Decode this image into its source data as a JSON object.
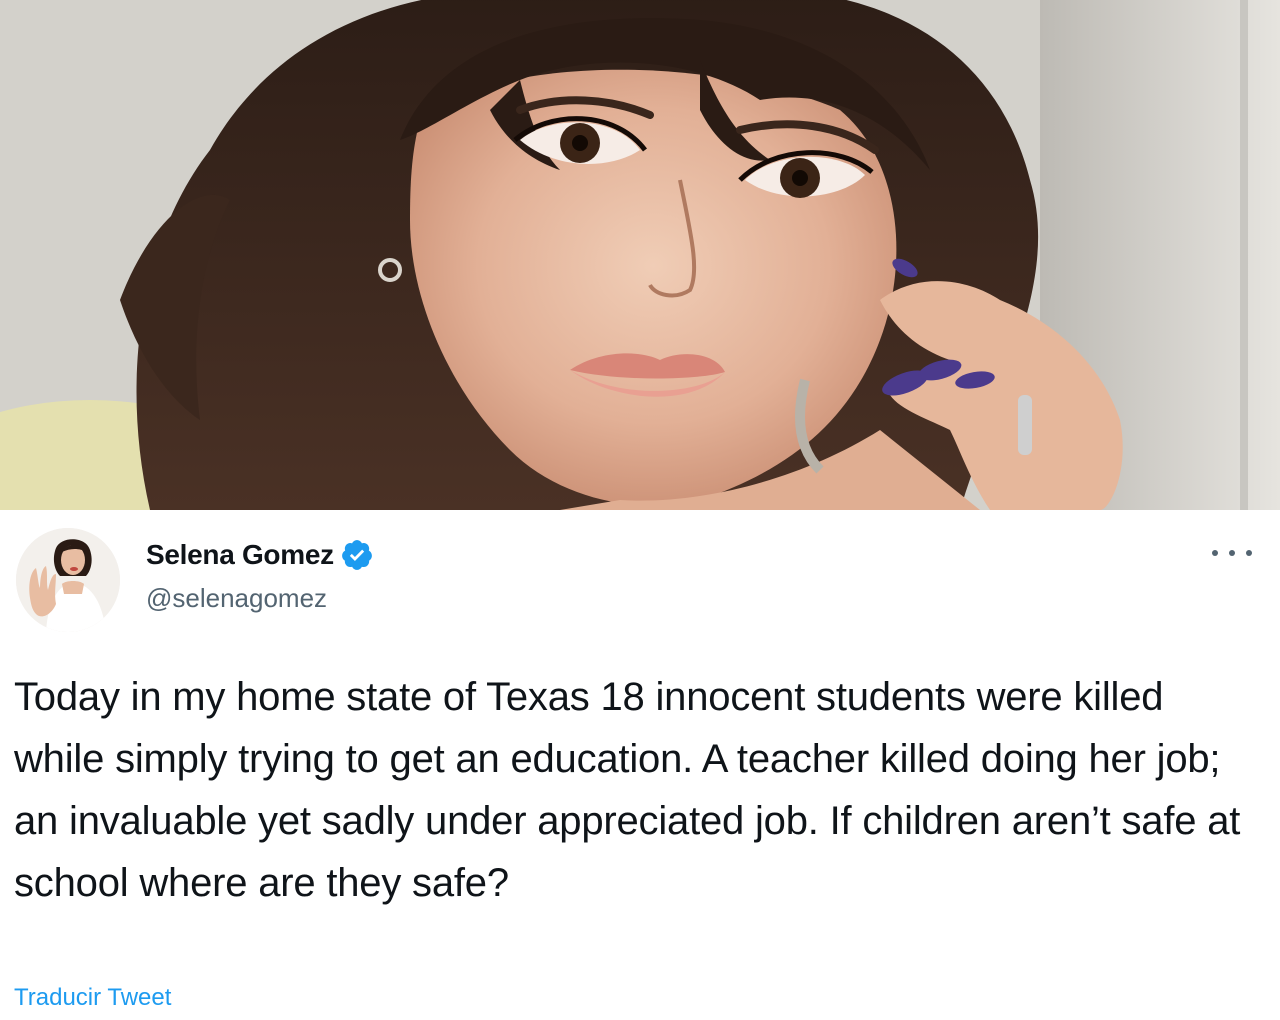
{
  "tweet": {
    "display_name": "Selena Gomez",
    "handle": "@selenagomez",
    "verified": true,
    "text": "Today in my home state of Texas 18 innocent students were killed while simply trying to get an education. A teacher killed doing her job; an invaluable yet sadly under appreciated job. If children aren’t safe at school where are they safe?",
    "translate_label": "Traducir Tweet"
  },
  "icons": {
    "verified": "verified-badge-icon",
    "more": "more-options-icon"
  },
  "colors": {
    "accent": "#1d9bf0",
    "text_primary": "#0f1419",
    "text_secondary": "#536471"
  }
}
